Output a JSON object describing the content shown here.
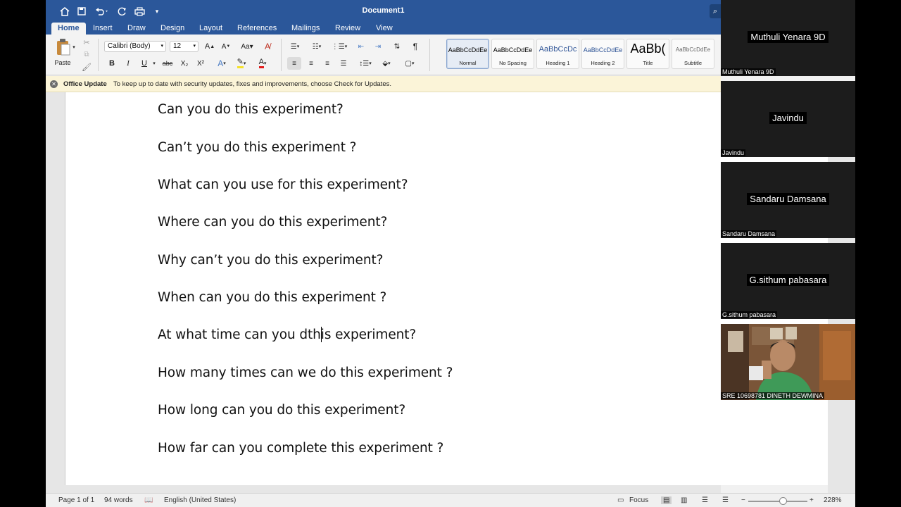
{
  "titlebar": {
    "doc_title": "Document1"
  },
  "tabs": [
    "Home",
    "Insert",
    "Draw",
    "Design",
    "Layout",
    "References",
    "Mailings",
    "Review",
    "View"
  ],
  "ribbon": {
    "paste_label": "Paste",
    "font_name": "Calibri (Body)",
    "font_size": "12",
    "bold": "B",
    "italic": "I",
    "underline": "U",
    "strike": "abc",
    "subscript": "X₂",
    "superscript": "X²",
    "styles": [
      {
        "sample": "AaBbCcDdEe",
        "name": "Normal"
      },
      {
        "sample": "AaBbCcDdEe",
        "name": "No Spacing"
      },
      {
        "sample": "AaBbCcDc",
        "name": "Heading 1"
      },
      {
        "sample": "AaBbCcDdEe",
        "name": "Heading 2"
      },
      {
        "sample": "AaBb(",
        "name": "Title"
      },
      {
        "sample": "AaBbCcDdEe",
        "name": "Subtitle"
      }
    ]
  },
  "infobar": {
    "title": "Office Update",
    "message": "To keep up to date with security updates, fixes and improvements, choose Check for Updates."
  },
  "document": {
    "lines": [
      "Can you do this experiment?",
      "Can’t you do this experiment ?",
      "What can you use for this experiment?",
      "Where can you do this experiment?",
      "Why can’t you do this experiment?",
      "When can you do this experiment ?",
      "At what time can you dthis experiment?",
      "How many times can we do this experiment ?",
      "How long can you do this experiment?",
      "How far can you complete this experiment ?"
    ]
  },
  "statusbar": {
    "page": "Page 1 of 1",
    "words": "94 words",
    "language": "English (United States)",
    "focus": "Focus",
    "zoom": "228%"
  },
  "participants": [
    {
      "display": "Muthuli Yenara 9D",
      "label": "Muthuli Yenara 9D"
    },
    {
      "display": "Javindu",
      "label": "Javindu"
    },
    {
      "display": "Sandaru Damsana",
      "label": "Sandaru Damsana"
    },
    {
      "display": "G.sithum pabasara",
      "label": "G.sithum pabasara"
    },
    {
      "display": "",
      "label": "SRE 10698781 DINETH DEWMINA"
    }
  ],
  "colors": {
    "word_blue": "#2b579a",
    "infobar_bg": "#fbf4d8"
  }
}
